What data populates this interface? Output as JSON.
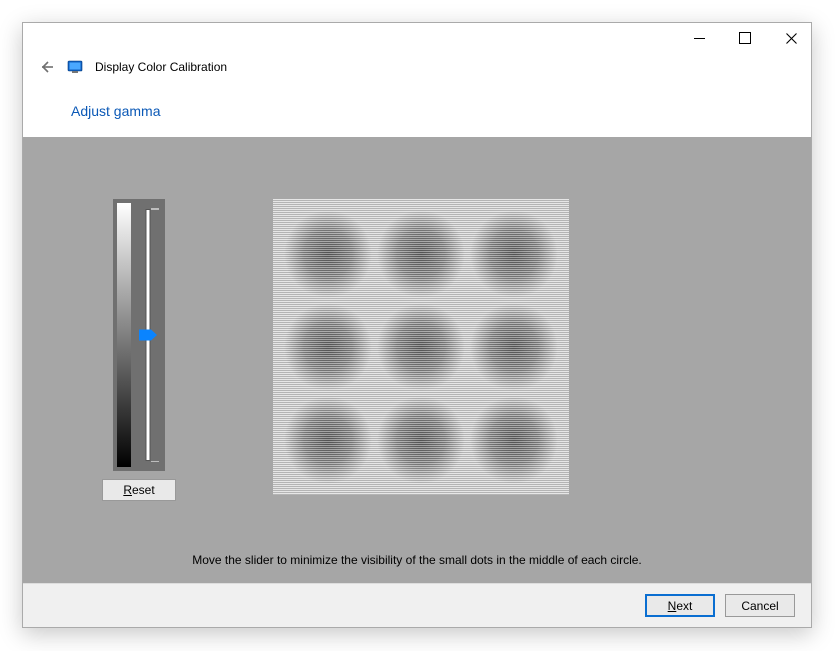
{
  "window": {
    "app_title": "Display Color Calibration",
    "page_heading": "Adjust gamma"
  },
  "slider": {
    "position_percent": 50
  },
  "buttons": {
    "reset": "Reset",
    "next": "Next",
    "cancel": "Cancel"
  },
  "instruction": "Move the slider to minimize the visibility of the small dots in the middle of each circle."
}
